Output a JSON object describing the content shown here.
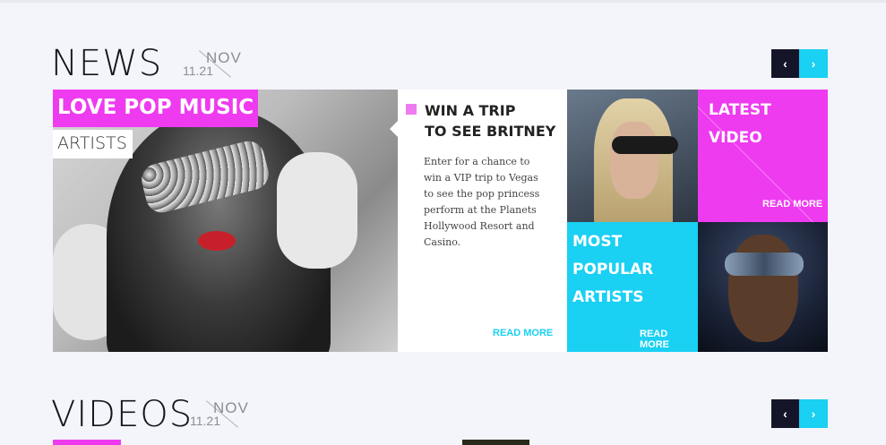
{
  "news": {
    "title": "NEWS",
    "date_day": "11.21",
    "date_month": "NOV",
    "nav_prev": "‹",
    "nav_next": "›"
  },
  "hero": {
    "label": "LOVE POP MUSIC",
    "sublabel": "ARTISTS"
  },
  "article": {
    "title_line1": "WIN A TRIP",
    "title_line2": "TO SEE BRITNEY",
    "body": "Enter for a chance to win a VIP trip to Vegas to see the pop princess perform at the Planets Hollywood Resort and Casino.",
    "read_more": "READ MORE"
  },
  "tiles": {
    "latest": {
      "title": "LATEST VIDEO",
      "read_more": "READ MORE"
    },
    "popular": {
      "title_line1": "MOST POPULAR",
      "title_line2": "ARTISTS",
      "read_more": "READ MORE"
    }
  },
  "videos": {
    "title": "VIDEOS",
    "date_day": "11.21",
    "date_month": "NOV",
    "nav_prev": "‹",
    "nav_next": "›"
  },
  "colors": {
    "magenta": "#ee3bf0",
    "cyan": "#1ad0f3",
    "navy": "#15152a"
  },
  "icons": {
    "prev": "chevron-left-icon",
    "next": "chevron-right-icon"
  }
}
